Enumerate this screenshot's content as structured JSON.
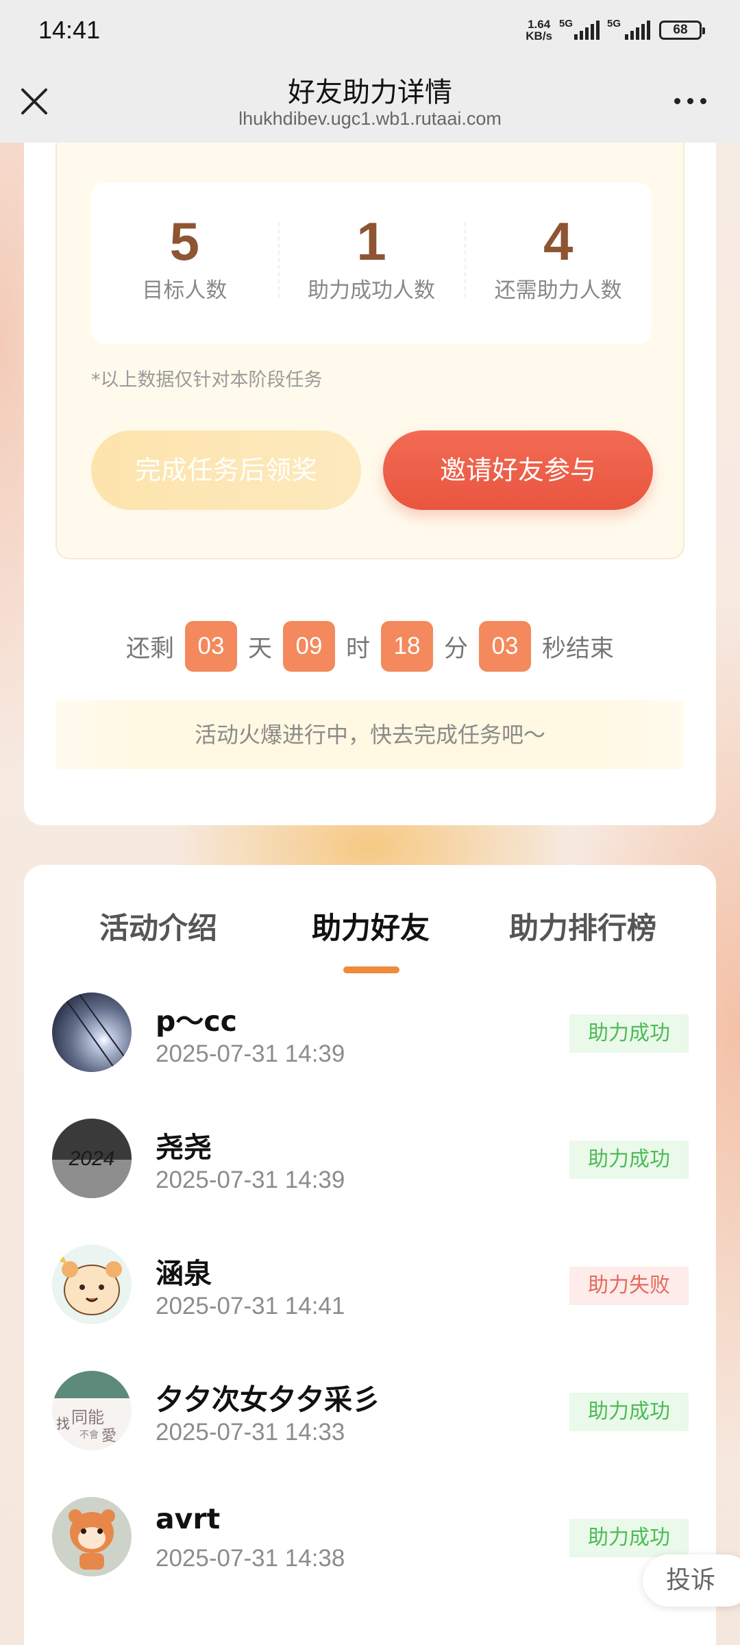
{
  "status_bar": {
    "time": "14:41",
    "net_speed_value": "1.64",
    "net_speed_unit": "KB/s",
    "signal1_label": "5G",
    "signal2_label": "5G",
    "battery": "68"
  },
  "nav": {
    "title": "好友助力详情",
    "url": "lhukhdibev.ugc1.wb1.rutaai.com"
  },
  "stats": [
    {
      "value": "5",
      "label": "目标人数"
    },
    {
      "value": "1",
      "label": "助力成功人数"
    },
    {
      "value": "4",
      "label": "还需助力人数"
    }
  ],
  "note": "*以上数据仅针对本阶段任务",
  "buttons": {
    "claim": "完成任务后领奖",
    "invite": "邀请好友参与"
  },
  "countdown": {
    "prefix": "还剩",
    "days": "03",
    "days_unit": "天",
    "hours": "09",
    "hours_unit": "时",
    "minutes": "18",
    "minutes_unit": "分",
    "seconds": "03",
    "seconds_unit": "秒结束"
  },
  "activity_text": "活动火爆进行中，快去完成任务吧～",
  "tabs": [
    {
      "label": "活动介绍"
    },
    {
      "label": "助力好友"
    },
    {
      "label": "助力排行榜"
    }
  ],
  "active_tab": "助力好友",
  "friends": [
    {
      "name": "p～cc",
      "date": "2025-07-31 14:39",
      "status": "助力成功"
    },
    {
      "name": "尧尧",
      "date": "2025-07-31 14:39",
      "status": "助力成功"
    },
    {
      "name": "涵泉",
      "date": "2025-07-31 14:41",
      "status": "助力失败"
    },
    {
      "name": "夕夕次女夕夕采彡",
      "date": "2025-07-31 14:33",
      "status": "助力成功"
    },
    {
      "name": "avrt",
      "date": "2025-07-31 14:38",
      "status": "助力成功"
    }
  ],
  "avatar_texts": {
    "a2": "2024",
    "a4_1": "找",
    "a4_2": "同能",
    "a4_3": "不會",
    "a4_4": "愛"
  },
  "complain": "投诉",
  "colors": {
    "accent_orange": "#ee8a3c",
    "invite_red": "#e9553f",
    "countdown_box": "#f3895c",
    "stat_number": "#8e5533",
    "success_green": "#4cbb58",
    "fail_red": "#e46a5d"
  }
}
